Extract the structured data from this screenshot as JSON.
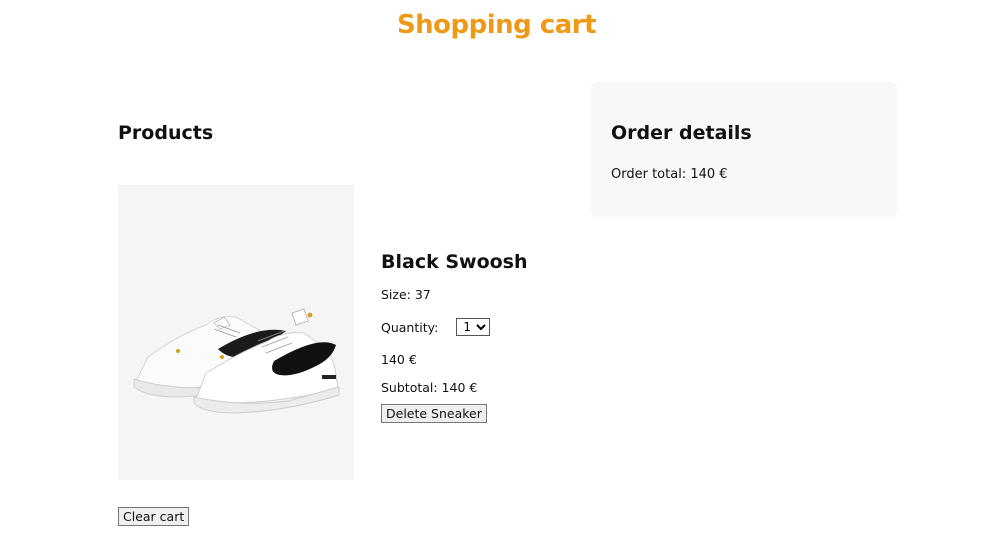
{
  "page": {
    "title": "Shopping cart"
  },
  "products": {
    "heading": "Products",
    "items": [
      {
        "name": "Black Swoosh",
        "size_text": "Size: 37",
        "quantity_label": "Quantity:",
        "quantity_value": "1",
        "price_text": "140 €",
        "subtotal_text": "Subtotal: 140 €",
        "delete_label": "Delete Sneaker",
        "image_alt_icon": "sneaker-image"
      }
    ],
    "clear_label": "Clear cart"
  },
  "order": {
    "heading": "Order details",
    "total_text": "Order total: 140 €"
  },
  "colors": {
    "accent": "#ef9a16",
    "panel_bg": "#f7f8fa",
    "image_bg": "#f5f5f5"
  }
}
